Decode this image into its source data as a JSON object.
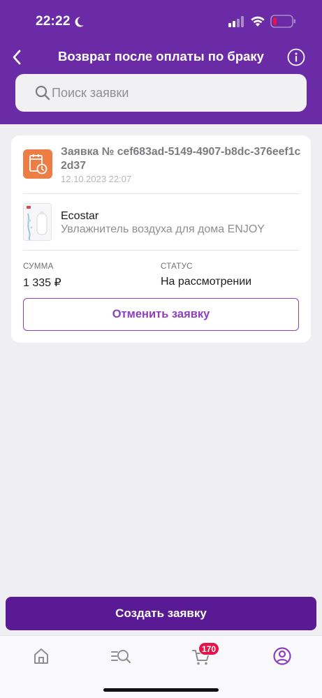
{
  "status_bar": {
    "time": "22:22"
  },
  "nav": {
    "title": "Возврат после оплаты по браку"
  },
  "search": {
    "placeholder": "Поиск заявки"
  },
  "request": {
    "title": "Заявка № cef683ad-5149-4907-b8dc-376eef1c2d37",
    "date": "12.10.2023 22:07",
    "product_brand": "Ecostar",
    "product_name": "Увлажнитель воздуха для дома ENJOY",
    "sum_label": "СУММА",
    "sum_value": "1 335 ₽",
    "status_label": "СТАТУС",
    "status_value": "На рассмотрении",
    "cancel_label": "Отменить заявку"
  },
  "footer": {
    "create_label": "Создать заявку"
  },
  "tab_bar": {
    "items": [
      {
        "icon": "home-icon"
      },
      {
        "icon": "catalog-search-icon"
      },
      {
        "icon": "cart-icon",
        "badge": "170"
      },
      {
        "icon": "profile-icon"
      }
    ]
  },
  "colors": {
    "brand_purple": "#6b2aa6",
    "button_purple": "#5a1a96",
    "accent_purple": "#8d3fbd",
    "request_icon_orange": "#ec7e45",
    "badge_red": "#e5154a",
    "battery_red": "#e5154a"
  }
}
